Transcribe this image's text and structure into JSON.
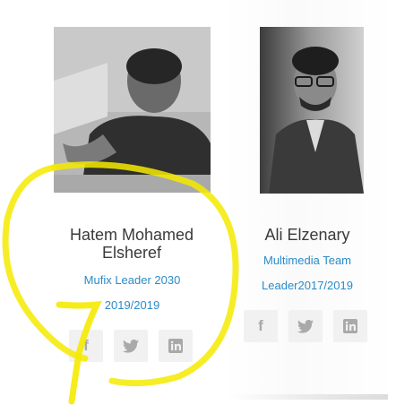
{
  "members": [
    {
      "name": "Hatem Mohamed Elsheref",
      "role_line1": "Mufix Leader 2030",
      "role_line2": "2019/2019",
      "photo_icon": "person-photo-icon"
    },
    {
      "name": "Ali Elzenary",
      "role_line1": "Multimedia Team",
      "role_line2": "Leader2017/2019",
      "photo_icon": "person-photo-icon"
    }
  ],
  "social": {
    "facebook_label": "f",
    "twitter_icon": "twitter-icon",
    "linkedin_icon": "linkedin-icon"
  },
  "colors": {
    "role_text": "#2a8bc8",
    "name_text": "#3a3a3a",
    "social_bg": "#f1f1f1",
    "highlight": "#f5ea00"
  }
}
